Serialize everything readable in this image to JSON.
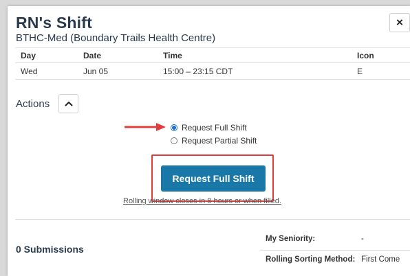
{
  "modal": {
    "title": "RN's Shift",
    "subtitle": "BTHC-Med (Boundary Trails Health Centre)",
    "close_label": "×"
  },
  "table": {
    "headers": [
      "Day",
      "Date",
      "Time",
      "Icon"
    ],
    "rows": [
      [
        "Wed",
        "Jun 05",
        "15:00 – 23:15 CDT",
        "E"
      ]
    ]
  },
  "actions": {
    "label": "Actions",
    "options": [
      {
        "label": "Request Full Shift",
        "checked": true
      },
      {
        "label": "Request Partial Shift",
        "checked": false
      }
    ],
    "submit_label": "Request Full Shift",
    "note": "Rolling window closes in 8 hours or when filled."
  },
  "submissions": {
    "label": "0 Submissions"
  },
  "meta": {
    "seniority_label": "My Seniority:",
    "seniority_value": "-",
    "sorting_label": "Rolling Sorting Method:",
    "sorting_value": "First Come"
  },
  "colors": {
    "primary": "#1a78a8",
    "annotation": "#e03c3c",
    "heading": "#2a3a4d"
  },
  "icons": {
    "close": "close-icon",
    "toggle": "chevron-up-icon",
    "annotation": "arrow-right-icon"
  }
}
